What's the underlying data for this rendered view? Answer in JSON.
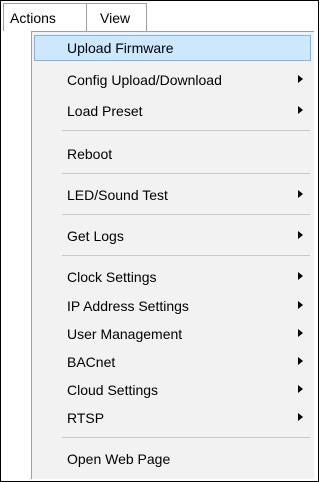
{
  "menubar": {
    "items": [
      {
        "label": "Actions"
      },
      {
        "label": "View"
      }
    ]
  },
  "menu": {
    "items": [
      {
        "label": "Upload Firmware",
        "submenu": false,
        "highlighted": true
      },
      {
        "label": "Config Upload/Download",
        "submenu": true
      },
      {
        "label": "Load Preset",
        "submenu": true
      },
      {
        "label": "Reboot",
        "submenu": false
      },
      {
        "label": "LED/Sound Test",
        "submenu": true
      },
      {
        "label": "Get Logs",
        "submenu": true
      },
      {
        "label": "Clock Settings",
        "submenu": true
      },
      {
        "label": "IP Address Settings",
        "submenu": true
      },
      {
        "label": "User Management",
        "submenu": true
      },
      {
        "label": "BACnet",
        "submenu": true
      },
      {
        "label": "Cloud Settings",
        "submenu": true
      },
      {
        "label": "RTSP",
        "submenu": true
      },
      {
        "label": "Open Web Page",
        "submenu": false
      }
    ]
  },
  "colors": {
    "highlight_bg": "#cce8ff",
    "highlight_border": "#7ab4e8",
    "menu_bg": "#f2f2f2"
  },
  "icons": [
    "submenu-arrow-icon"
  ]
}
